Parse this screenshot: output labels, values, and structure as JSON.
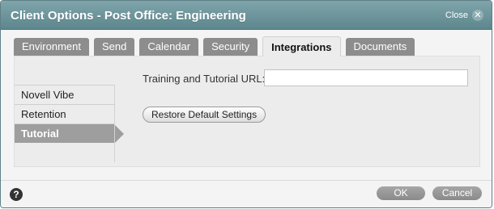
{
  "dialog": {
    "title": "Client Options - Post Office: Engineering",
    "close_label": "Close",
    "close_icon": "close-icon"
  },
  "tabs": [
    {
      "label": "Environment",
      "active": false
    },
    {
      "label": "Send",
      "active": false
    },
    {
      "label": "Calendar",
      "active": false
    },
    {
      "label": "Security",
      "active": false
    },
    {
      "label": "Integrations",
      "active": true
    },
    {
      "label": "Documents",
      "active": false
    }
  ],
  "sidebar": {
    "items": [
      {
        "label": "Novell Vibe",
        "selected": false
      },
      {
        "label": "Retention",
        "selected": false
      },
      {
        "label": "Tutorial",
        "selected": true
      }
    ]
  },
  "form": {
    "url_label": "Training and Tutorial URL:",
    "url_value": "",
    "restore_button": "Restore Default Settings"
  },
  "footer": {
    "help_icon": "help-icon",
    "help_glyph": "?",
    "ok_label": "OK",
    "cancel_label": "Cancel"
  },
  "colors": {
    "titlebar": "#6b9299",
    "tab_inactive": "#8d8d8d",
    "sidebar_selected": "#9e9e9e",
    "footer_button": "#999999"
  }
}
